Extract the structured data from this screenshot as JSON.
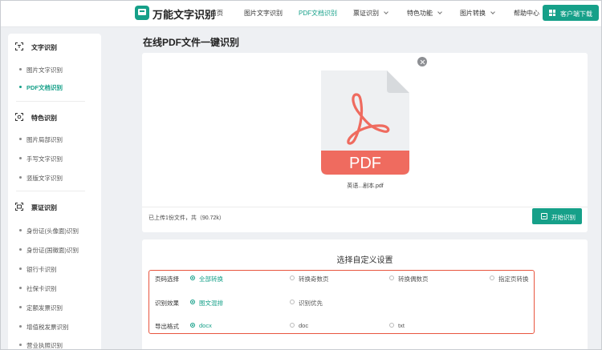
{
  "header": {
    "brand": "万能文字识别",
    "nav": [
      {
        "label": "首页",
        "active": false,
        "dropdown": false
      },
      {
        "label": "图片文字识别",
        "active": false,
        "dropdown": false
      },
      {
        "label": "PDF文档识别",
        "active": true,
        "dropdown": false
      },
      {
        "label": "票证识别",
        "active": false,
        "dropdown": true
      },
      {
        "label": "特色功能",
        "active": false,
        "dropdown": true
      },
      {
        "label": "图片转换",
        "active": false,
        "dropdown": true
      },
      {
        "label": "帮助中心",
        "active": false,
        "dropdown": false
      }
    ],
    "download_label": "客户端下载"
  },
  "sidebar": {
    "categories": [
      {
        "label": "文字识别",
        "icon": "scan-text-icon",
        "items": [
          {
            "label": "图片文字识别",
            "active": false
          },
          {
            "label": "PDF文档识别",
            "active": true
          }
        ]
      },
      {
        "label": "特色识别",
        "icon": "scan-target-icon",
        "items": [
          {
            "label": "图片局部识别",
            "active": false
          },
          {
            "label": "手写文字识别",
            "active": false
          },
          {
            "label": "竖版文字识别",
            "active": false
          }
        ]
      },
      {
        "label": "票证识别",
        "icon": "scan-ticket-icon",
        "items": [
          {
            "label": "身份证(头像面)识别",
            "active": false
          },
          {
            "label": "身份证(国徽面)识别",
            "active": false
          },
          {
            "label": "银行卡识别",
            "active": false
          },
          {
            "label": "社保卡识别",
            "active": false
          },
          {
            "label": "定额发票识别",
            "active": false
          },
          {
            "label": "增值税发票识别",
            "active": false
          },
          {
            "label": "营业执照识别",
            "active": false
          }
        ]
      }
    ]
  },
  "main": {
    "title": "在线PDF文件一键识别",
    "file": {
      "name": "英语...剧本.pdf",
      "type_label": "PDF",
      "icon": "pdf-file-icon"
    },
    "status": "已上传1份文件，共（90.72k）",
    "start_label": "开始识别",
    "settings": {
      "title": "选择自定义设置",
      "rows": [
        {
          "label": "页码选择",
          "options": [
            {
              "label": "全部转换",
              "checked": true
            },
            {
              "label": "转换奇数页",
              "checked": false
            },
            {
              "label": "转换偶数页",
              "checked": false
            },
            {
              "label": "指定页转换",
              "checked": false
            }
          ]
        },
        {
          "label": "识别效果",
          "options": [
            {
              "label": "图文混排",
              "checked": true
            },
            {
              "label": "识别优先",
              "checked": false
            }
          ]
        },
        {
          "label": "导出格式",
          "options": [
            {
              "label": "docx",
              "checked": true
            },
            {
              "label": "doc",
              "checked": false
            },
            {
              "label": "txt",
              "checked": false
            }
          ]
        }
      ]
    }
  },
  "colors": {
    "accent": "#16a089",
    "highlight_border": "#e8553f",
    "pdf_red": "#ef6b5f"
  }
}
